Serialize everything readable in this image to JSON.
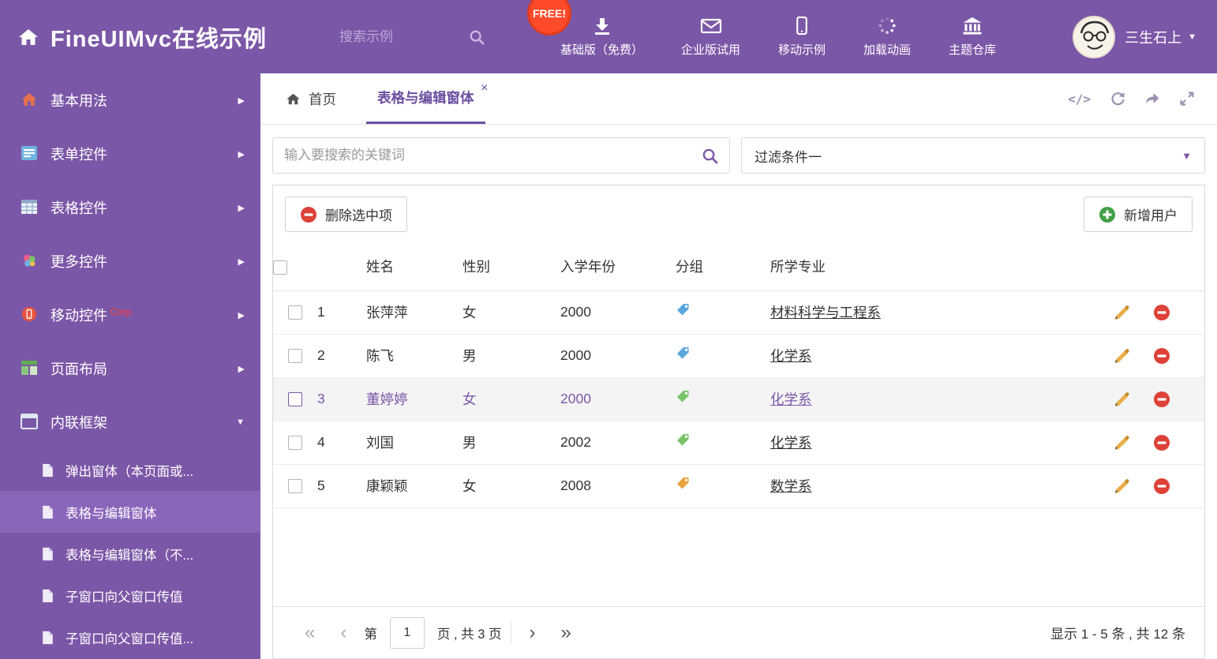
{
  "colors": {
    "accent": "#7b57a7",
    "sidebar_selected": "#8a66bb",
    "badge_red": "#ff4b2a",
    "delete_red": "#dd4138",
    "add_green": "#43a047",
    "tag_blue": "#5aa7dd",
    "tag_green": "#79c36a",
    "tag_orange": "#e8a23d"
  },
  "header": {
    "title": "FineUIMvc在线示例",
    "search_placeholder": "搜索示例",
    "free_badge": "FREE!",
    "nav": [
      {
        "label": "基础版（免费）",
        "icon": "download-icon"
      },
      {
        "label": "企业版试用",
        "icon": "envelope-icon"
      },
      {
        "label": "移动示例",
        "icon": "mobile-icon"
      },
      {
        "label": "加载动画",
        "icon": "spinner-icon"
      },
      {
        "label": "主题仓库",
        "icon": "bank-icon"
      }
    ],
    "user_name": "三生石上",
    "user_caret": "▼"
  },
  "sidebar": {
    "items": [
      {
        "label": "基本用法",
        "icon": "home-icon",
        "arrow": "▶"
      },
      {
        "label": "表单控件",
        "icon": "form-icon",
        "arrow": "▶"
      },
      {
        "label": "表格控件",
        "icon": "table-icon",
        "arrow": "▶"
      },
      {
        "label": "更多控件",
        "icon": "flower-icon",
        "arrow": "▶"
      },
      {
        "label": "移动控件",
        "badge": "Corp.",
        "icon": "mobile-red-icon",
        "arrow": "▶"
      },
      {
        "label": "页面布局",
        "icon": "layout-icon",
        "arrow": "▶"
      },
      {
        "label": "内联框架",
        "icon": "frame-icon",
        "arrow": "▼"
      }
    ],
    "subitems": [
      "弹出窗体（本页面或...",
      "表格与编辑窗体",
      "表格与编辑窗体（不...",
      "子窗口向父窗口传值",
      "子窗口向父窗口传值..."
    ]
  },
  "tabs": {
    "home_label": "首页",
    "active_label": "表格与编辑窗体",
    "close_glyph": "×"
  },
  "filter": {
    "search_placeholder": "输入要搜索的关键词",
    "dropdown_value": "过滤条件一",
    "dropdown_caret": "▼"
  },
  "toolbar": {
    "delete_label": "删除选中项",
    "add_label": "新增用户"
  },
  "table": {
    "columns": {
      "name": "姓名",
      "gender": "性别",
      "year": "入学年份",
      "group": "分组",
      "major": "所学专业"
    },
    "rows": [
      {
        "num": "1",
        "name": "张萍萍",
        "gender": "女",
        "year": "2000",
        "tag_color": "#5aa7dd",
        "major": "材料科学与工程系",
        "selected": false
      },
      {
        "num": "2",
        "name": "陈飞",
        "gender": "男",
        "year": "2000",
        "tag_color": "#5aa7dd",
        "major": "化学系",
        "selected": false
      },
      {
        "num": "3",
        "name": "董婷婷",
        "gender": "女",
        "year": "2000",
        "tag_color": "#79c36a",
        "major": "化学系",
        "selected": true
      },
      {
        "num": "4",
        "name": "刘国",
        "gender": "男",
        "year": "2002",
        "tag_color": "#79c36a",
        "major": "化学系",
        "selected": false
      },
      {
        "num": "5",
        "name": "康颖颖",
        "gender": "女",
        "year": "2008",
        "tag_color": "#e8a23d",
        "major": "数学系",
        "selected": false
      }
    ]
  },
  "pager": {
    "first": "«",
    "prev": "‹",
    "next": "›",
    "last": "»",
    "page_prefix": "第",
    "page_value": "1",
    "page_suffix": "页 , 共 3 页",
    "summary": "显示 1 - 5 条 , 共 12 条"
  }
}
